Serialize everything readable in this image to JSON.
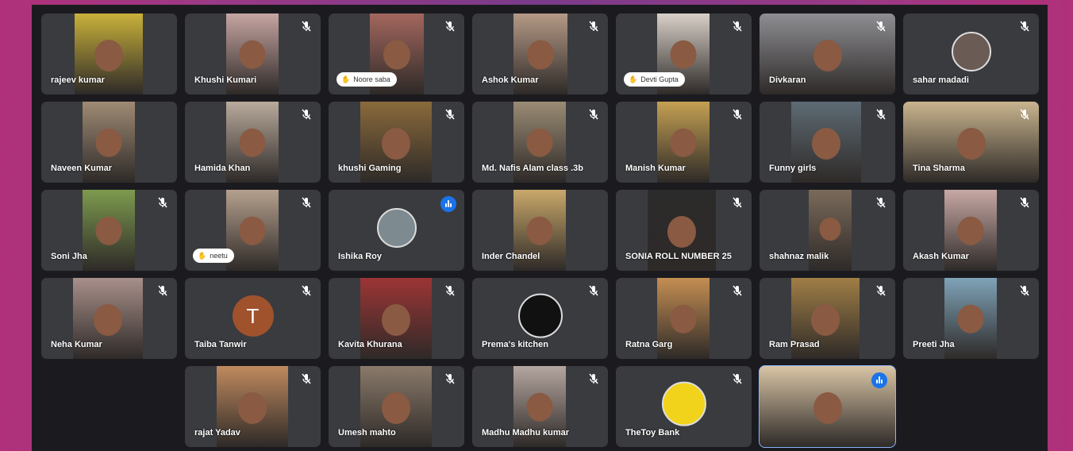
{
  "colors": {
    "tile": "#3a3b3f",
    "stage": "#1b1b1f",
    "speaking": "#1a73e8",
    "letter_avatar": "#a0522d"
  },
  "participants": [
    {
      "name": "rajeev kumar",
      "muted": false,
      "video": "#c9b13a"
    },
    {
      "name": "Khushi Kumari",
      "muted": true,
      "video": "#c6a5a2"
    },
    {
      "name": "Noore saba",
      "muted": true,
      "hand": true,
      "video": "#a3675e"
    },
    {
      "name": "Ashok Kumar",
      "muted": true,
      "video": "#b59a86"
    },
    {
      "name": "Devti Gupta",
      "muted": true,
      "hand": true,
      "video": "#d8d0c8"
    },
    {
      "name": "Divkaran",
      "muted": true,
      "video": "#8e8e93"
    },
    {
      "name": "sahar madadi",
      "muted": true,
      "avatar": true,
      "video": "#6b5b55"
    },
    {
      "name": "Naveen Kumar",
      "muted": false,
      "video": "#9f8a74"
    },
    {
      "name": "Hamida Khan",
      "muted": true,
      "video": "#b9aa9c"
    },
    {
      "name": "khushi Gaming",
      "muted": true,
      "video": "#8a6a3b"
    },
    {
      "name": "Md. Nafis Alam class .3b",
      "muted": true,
      "video": "#9a8b74"
    },
    {
      "name": "Manish Kumar",
      "muted": true,
      "video": "#c4a052"
    },
    {
      "name": "Funny girls",
      "muted": true,
      "video": "#5e6b74"
    },
    {
      "name": "Tina Sharma",
      "muted": true,
      "video": "#c9b48e"
    },
    {
      "name": "Soni Jha",
      "muted": true,
      "video": "#7d9a4e"
    },
    {
      "name": "neetu",
      "muted": true,
      "hand": true,
      "video": "#b5a08e"
    },
    {
      "name": "Ishika Roy",
      "muted": false,
      "speaking": true,
      "avatar": true,
      "video": "#7d8a90"
    },
    {
      "name": "Inder Chandel",
      "muted": false,
      "video": "#c9a86a"
    },
    {
      "name": "SONIA ROLL NUMBER 25",
      "muted": true,
      "video": "#2b2b2b"
    },
    {
      "name": "shahnaz malik",
      "muted": true,
      "video": "#7a6a5a"
    },
    {
      "name": "Akash Kumar",
      "muted": true,
      "video": "#c7a8a4"
    },
    {
      "name": "Neha Kumar",
      "muted": true,
      "video": "#a8908a"
    },
    {
      "name": "Taiba Tanwir",
      "muted": true,
      "letter": "T",
      "video": ""
    },
    {
      "name": "Kavita Khurana",
      "muted": true,
      "video": "#9c3535"
    },
    {
      "name": "Prema's kitchen",
      "muted": true,
      "avatar": true,
      "avatar_color": "#111111",
      "video": ""
    },
    {
      "name": "Ratna Garg",
      "muted": true,
      "video": "#c48e52"
    },
    {
      "name": "Ram Prasad",
      "muted": true,
      "video": "#a07e46"
    },
    {
      "name": "Preeti Jha",
      "muted": true,
      "video": "#7fa3b8"
    },
    {
      "name": "rajat Yadav",
      "muted": true,
      "video": "#c08a5e"
    },
    {
      "name": "Umesh mahto",
      "muted": true,
      "video": "#8a7a6a"
    },
    {
      "name": "Madhu Madhu kumar",
      "muted": true,
      "video": "#b5a6a0"
    },
    {
      "name": "TheToy Bank",
      "muted": true,
      "avatar": true,
      "avatar_color": "#f2d31b",
      "video": ""
    },
    {
      "name": "",
      "muted": false,
      "speaking": true,
      "self": true,
      "video": "#d9c5a6"
    }
  ]
}
